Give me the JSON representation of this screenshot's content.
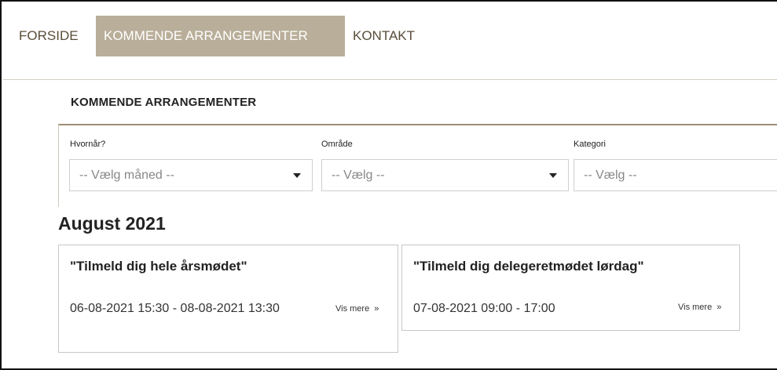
{
  "nav": {
    "items": [
      {
        "label": "FORSIDE",
        "active": false
      },
      {
        "label": "KOMMENDE ARRANGEMENTER",
        "active": true
      },
      {
        "label": "KONTAKT",
        "active": false
      }
    ]
  },
  "section": {
    "title": "KOMMENDE ARRANGEMENTER"
  },
  "filters": {
    "when": {
      "label": "Hvornår?",
      "placeholder": "-- Vælg måned --"
    },
    "area": {
      "label": "Område",
      "placeholder": "-- Vælg --"
    },
    "category": {
      "label": "Kategori",
      "placeholder": "-- Vælg --"
    }
  },
  "month": {
    "title": "August 2021"
  },
  "events": [
    {
      "title": "\"Tilmeld dig hele årsmødet\"",
      "date": "06-08-2021 15:30 - 08-08-2021 13:30",
      "more": "Vis mere",
      "more_icon": "»"
    },
    {
      "title": "\"Tilmeld dig delegeretmødet lørdag\"",
      "date": "07-08-2021 09:00 - 17:00",
      "more": "Vis mere",
      "more_icon": "»"
    }
  ],
  "colors": {
    "nav_active_bg": "#b9ae99",
    "nav_text": "#5a4d3a",
    "panel_border": "#9c8f78"
  }
}
